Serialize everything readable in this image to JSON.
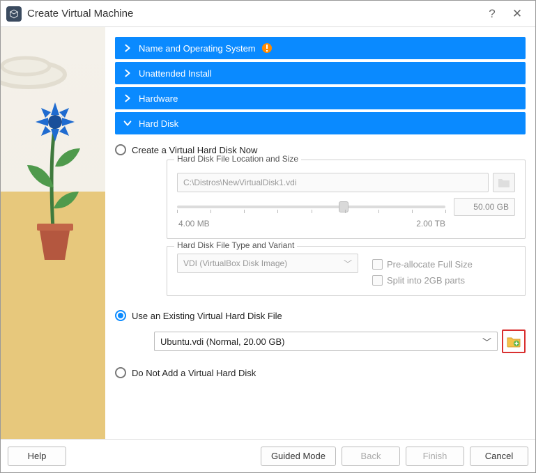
{
  "window": {
    "title": "Create Virtual Machine"
  },
  "sections": {
    "name": {
      "label": "Name and Operating System",
      "warn": true
    },
    "unattended": {
      "label": "Unattended Install"
    },
    "hardware": {
      "label": "Hardware"
    },
    "harddisk": {
      "label": "Hard Disk"
    }
  },
  "options": {
    "create": {
      "label": "Create a Virtual Hard Disk Now"
    },
    "existing": {
      "label": "Use an Existing Virtual Hard Disk File"
    },
    "none": {
      "label": "Do Not Add a Virtual Hard Disk"
    }
  },
  "create_group": {
    "loc_legend": "Hard Disk File Location and Size",
    "path": "C:\\Distros\\NewVirtualDisk1.vdi",
    "size_value": "50.00 GB",
    "axis_min": "4.00 MB",
    "axis_max": "2.00 TB",
    "type_legend": "Hard Disk File Type and Variant",
    "type_value": "VDI (VirtualBox Disk Image)",
    "prealloc": "Pre-allocate Full Size",
    "split": "Split into 2GB parts"
  },
  "existing_select": "Ubuntu.vdi (Normal, 20.00 GB)",
  "footer": {
    "help": "Help",
    "guided": "Guided Mode",
    "back": "Back",
    "finish": "Finish",
    "cancel": "Cancel"
  }
}
